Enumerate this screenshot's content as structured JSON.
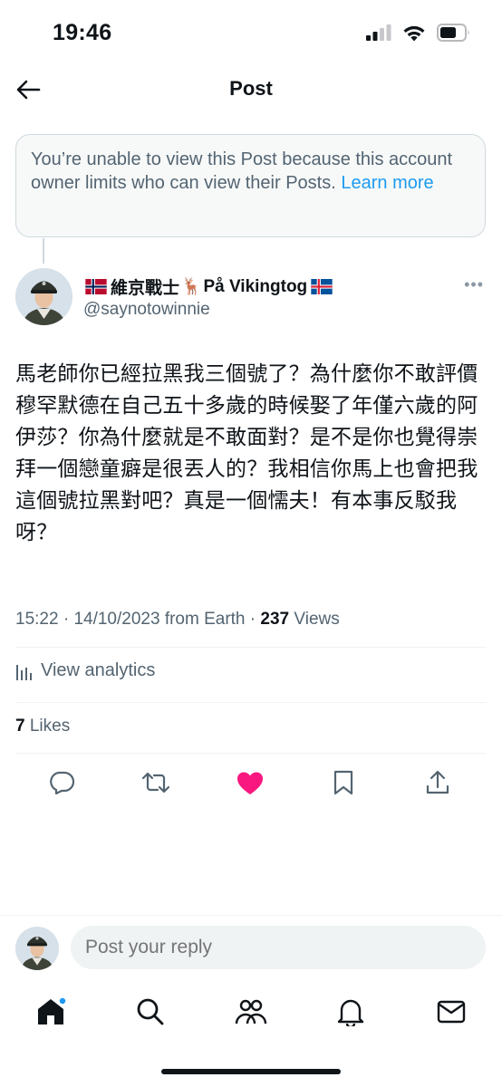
{
  "status_bar": {
    "time": "19:46"
  },
  "header": {
    "title": "Post"
  },
  "notice": {
    "text": "You’re unable to view this Post because this account owner limits who can view their Posts.",
    "link": "Learn more"
  },
  "author": {
    "name_flag_left": "norway-flag",
    "name": "維京戰士",
    "deer_emoji": "🦌",
    "name_suffix": "På Vikingtog",
    "name_flag_right": "iceland-flag",
    "handle": "@saynotowinnie",
    "more": "•••"
  },
  "post": {
    "text": "馬老師你已經拉黑我三個號了？為什麼你不敢評價穆罕默德在自己五十多歲的時候娶了年僅六歲的阿伊莎？你為什麼就是不敢面對？是不是你也覺得崇拜一個戀童癖是很丟人的？我相信你馬上也會把我這個號拉黑對吧？真是一個懦夫！有本事反駁我呀？",
    "time": "15:22",
    "date": "14/10/2023",
    "source": "from Earth",
    "separator": "·",
    "views_count": "237",
    "views_label": "Views"
  },
  "analytics": {
    "label": "View analytics"
  },
  "likes": {
    "count": "7",
    "label": "Likes"
  },
  "actions": [
    "reply-icon",
    "repost-icon",
    "like-icon",
    "bookmark-icon",
    "share-icon"
  ],
  "reply": {
    "placeholder": "Post your reply"
  },
  "tabbar": [
    "home-icon",
    "search-icon",
    "communities-icon",
    "notifications-icon",
    "messages-icon"
  ],
  "colors": {
    "accent": "#1d9bf0",
    "like": "#f91880",
    "text": "#0f1419",
    "muted": "#536471",
    "border": "#cfd9de"
  }
}
